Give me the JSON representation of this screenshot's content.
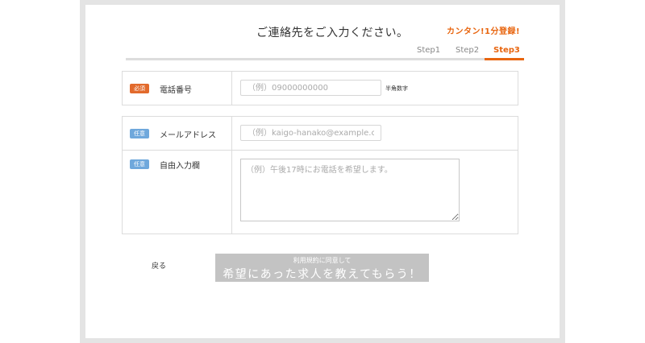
{
  "header": {
    "title": "ご連絡先をご入力ください。",
    "slogan": "カンタン!1分登録!"
  },
  "steps": [
    {
      "label": "Step1",
      "active": false
    },
    {
      "label": "Step2",
      "active": false
    },
    {
      "label": "Step3",
      "active": true
    }
  ],
  "colors": {
    "accent": "#e8650f",
    "required_badge": "#e26a2c",
    "optional_badge": "#6fa8dc",
    "submit_disabled": "#c3c3c3"
  },
  "form": {
    "phone": {
      "badge": "必須",
      "label": "電話番号",
      "placeholder": "（例）09000000000",
      "value": "",
      "hint": "半角数字"
    },
    "email": {
      "badge": "任意",
      "label": "メールアドレス",
      "placeholder": "（例）kaigo-hanako@example.com",
      "value": ""
    },
    "free_text": {
      "badge": "任意",
      "label": "自由入力欄",
      "placeholder": "（例）午後17時にお電話を希望します。",
      "value": ""
    }
  },
  "actions": {
    "back_label": "戻る",
    "submit_sub_label": "利用規約に同意して",
    "submit_main_label": "希望にあった求人を教えてもらう！"
  }
}
